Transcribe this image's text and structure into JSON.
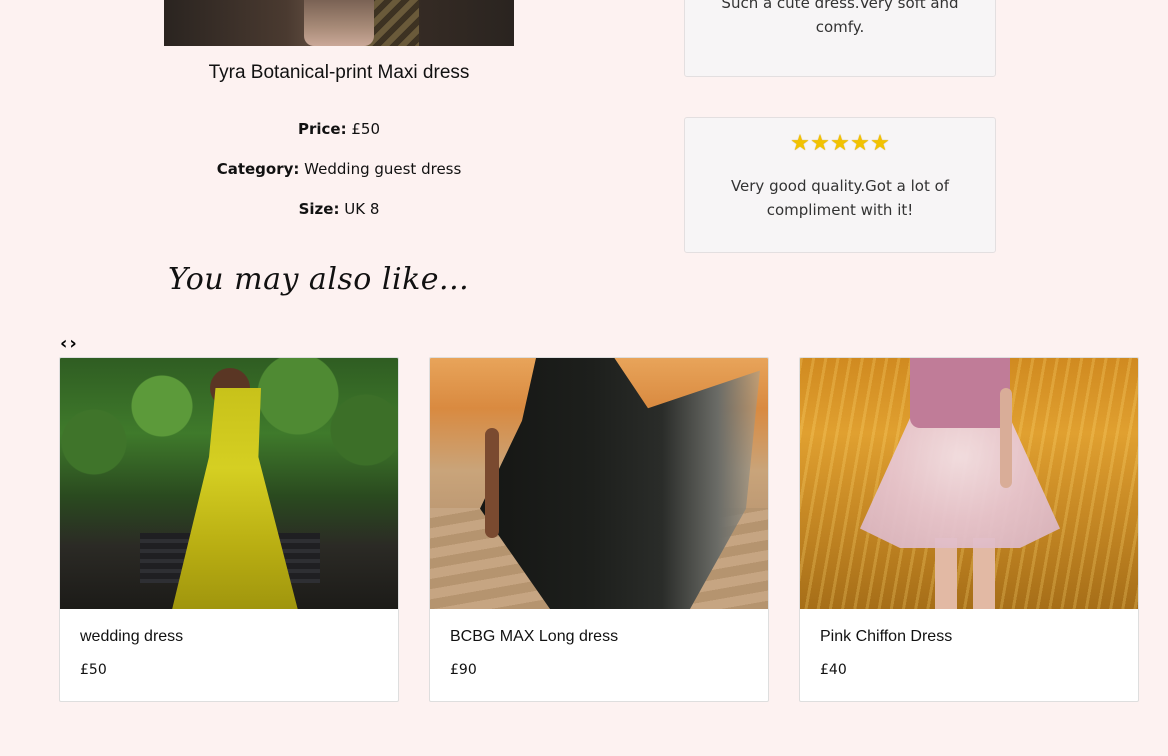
{
  "product": {
    "title": "Tyra Botanical-print Maxi dress",
    "price_label": "Price:",
    "price_value": "£50",
    "category_label": "Category:",
    "category_value": "Wedding guest dress",
    "size_label": "Size:",
    "size_value": "UK 8"
  },
  "reviews": [
    {
      "text": "Such a cute dress.Very soft and comfy."
    },
    {
      "rating": 5,
      "text": "Very good quality.Got a lot of compliment with it!"
    }
  ],
  "recommendations": {
    "heading": "You may also like...",
    "prev_icon": "chevron-left-icon",
    "next_icon": "chevron-right-icon",
    "items": [
      {
        "name": "wedding dress",
        "price": "£50"
      },
      {
        "name": "BCBG MAX Long dress",
        "price": "£90"
      },
      {
        "name": "Pink Chiffon Dress",
        "price": "£40"
      }
    ]
  },
  "colors": {
    "page_background": "#fdf2f1",
    "review_card_background": "#f7f5f6",
    "star": "#f2c200"
  }
}
